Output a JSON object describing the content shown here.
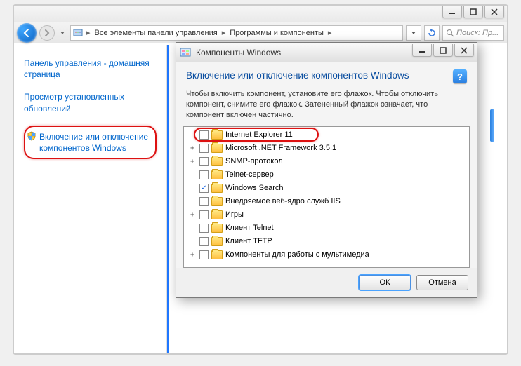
{
  "outer_window": {
    "breadcrumb": {
      "seg1": "Все элементы панели управления",
      "seg2": "Программы и компоненты"
    },
    "search_placeholder": "Поиск: Пр...",
    "sidebar": {
      "links": [
        {
          "label": "Панель управления - домашняя страница"
        },
        {
          "label": "Просмотр установленных обновлений"
        },
        {
          "label": "Включение или отключение компонентов Windows",
          "shield": true,
          "highlighted": true
        }
      ]
    }
  },
  "dialog": {
    "title": "Компоненты Windows",
    "heading": "Включение или отключение компонентов Windows",
    "description": "Чтобы включить компонент, установите его флажок. Чтобы отключить компонент, снимите его флажок. Затененный флажок означает, что компонент включен частично.",
    "tree": [
      {
        "expand": "",
        "checked": false,
        "label": "Internet Explorer 11",
        "highlighted": true
      },
      {
        "expand": "+",
        "checked": false,
        "label": "Microsoft .NET Framework 3.5.1"
      },
      {
        "expand": "+",
        "checked": false,
        "label": "SNMP-протокол"
      },
      {
        "expand": "",
        "checked": false,
        "label": "Telnet-сервер"
      },
      {
        "expand": "",
        "checked": true,
        "label": "Windows Search"
      },
      {
        "expand": "",
        "checked": false,
        "label": "Внедряемое веб-ядро служб IIS"
      },
      {
        "expand": "+",
        "checked": false,
        "label": "Игры"
      },
      {
        "expand": "",
        "checked": false,
        "label": "Клиент Telnet"
      },
      {
        "expand": "",
        "checked": false,
        "label": "Клиент TFTP"
      },
      {
        "expand": "+",
        "checked": false,
        "label": "Компоненты для работы с мультимедиа"
      }
    ],
    "buttons": {
      "ok": "ОК",
      "cancel": "Отмена"
    }
  }
}
